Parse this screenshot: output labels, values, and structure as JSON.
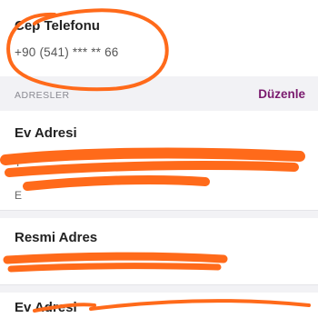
{
  "phone": {
    "label": "Cep Telefonu",
    "value": "+90 (541) *** ** 66"
  },
  "addresses_section": {
    "title": "ADRESLER",
    "edit_label": "Düzenle"
  },
  "addresses": [
    {
      "title": "Ev Adresi",
      "line1": "T",
      "line2": "",
      "line3": "E"
    },
    {
      "title": "Resmi Adres",
      "line1": ""
    },
    {
      "title": "Ev Adresi"
    }
  ],
  "colors": {
    "accent": "#7a1a6e",
    "redaction": "#ff6a1a"
  }
}
